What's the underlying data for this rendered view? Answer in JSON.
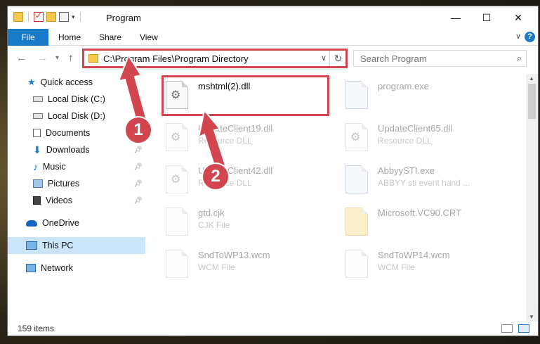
{
  "window": {
    "title": "Program",
    "minimize": "—",
    "maximize": "☐",
    "close": "✕"
  },
  "ribbon": {
    "tabs": [
      "File",
      "Home",
      "Share",
      "View"
    ],
    "help": "?"
  },
  "nav": {
    "back": "←",
    "forward": "→",
    "recent": "▾",
    "up": "↑",
    "address": "C:\\Program Files\\Program Directory",
    "search_placeholder": "Search Program"
  },
  "sidebar": {
    "items": [
      {
        "label": "Quick access",
        "icon": "star-icon"
      },
      {
        "label": "Local Disk (C:)",
        "icon": "drive-icon",
        "pinned": true
      },
      {
        "label": "Local Disk (D:)",
        "icon": "drive-icon"
      },
      {
        "label": "Documents",
        "icon": "documents-icon"
      },
      {
        "label": "Downloads",
        "icon": "downloads-icon",
        "pinned": true
      },
      {
        "label": "Music",
        "icon": "music-icon",
        "pinned": true
      },
      {
        "label": "Pictures",
        "icon": "pictures-icon",
        "pinned": true
      },
      {
        "label": "Videos",
        "icon": "videos-icon",
        "pinned": true
      },
      {
        "label": "OneDrive",
        "icon": "onedrive-icon"
      },
      {
        "label": "This PC",
        "icon": "this-pc-icon",
        "selected": true
      },
      {
        "label": "Network",
        "icon": "network-icon"
      }
    ]
  },
  "files": [
    {
      "name": "mshtml(2).dll",
      "type": "",
      "icon": "dll-icon",
      "highlighted": true
    },
    {
      "name": "program.exe",
      "type": "",
      "icon": "exe-icon"
    },
    {
      "name": "UpdateClient19.dll",
      "type": "Resource DLL",
      "icon": "dll-icon"
    },
    {
      "name": "UpdateClient65.dll",
      "type": "Resource DLL",
      "icon": "dll-icon"
    },
    {
      "name": "UpdateClient42.dll",
      "type": "Resource DLL",
      "icon": "dll-icon"
    },
    {
      "name": "AbbyySTI.exe",
      "type": "ABBYY sti event hand ...",
      "icon": "exe-icon"
    },
    {
      "name": "gtd.cjk",
      "type": "CJK File",
      "icon": "file-icon"
    },
    {
      "name": "Microsoft.VC90.CRT",
      "type": "",
      "icon": "folder-icon"
    },
    {
      "name": "SndToWP13.wcm",
      "type": "WCM File",
      "icon": "file-icon"
    },
    {
      "name": "SndToWP14.wcm",
      "type": "WCM File",
      "icon": "file-icon"
    }
  ],
  "status": {
    "item_count": "159 items"
  },
  "annotations": {
    "step1": "1",
    "step2": "2",
    "accent": "#d24650"
  }
}
